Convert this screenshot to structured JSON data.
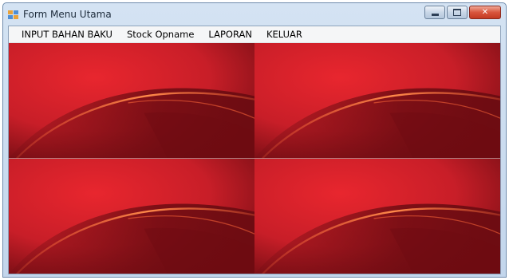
{
  "window": {
    "title": "Form Menu Utama",
    "app_icon": "form-icon",
    "controls": {
      "minimize_icon": "minimize-icon",
      "maximize_icon": "maximize-icon",
      "close_icon": "close-icon",
      "close_glyph": "✕"
    }
  },
  "menu": {
    "items": [
      {
        "label": "INPUT BAHAN BAKU"
      },
      {
        "label": "Stock Opname"
      },
      {
        "label": "LAPORAN"
      },
      {
        "label": "KELUAR"
      }
    ]
  },
  "background": {
    "tiles": 4,
    "colors": {
      "primary": "#c81e28",
      "dark": "#6e0c12",
      "highlight": "#ff6a3a",
      "glow": "#ff8a4a"
    }
  }
}
